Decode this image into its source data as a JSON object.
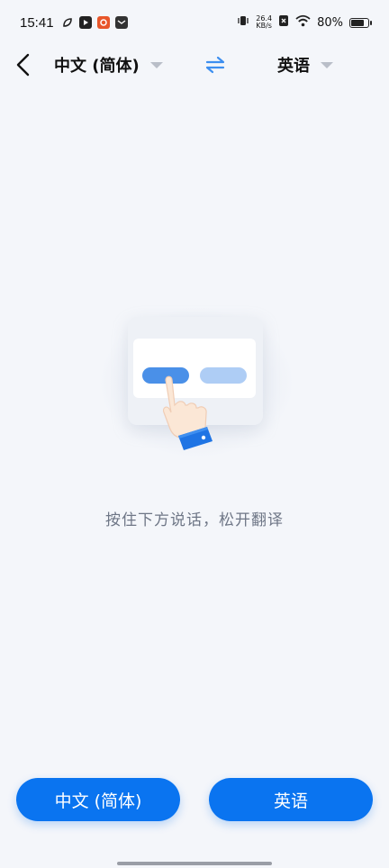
{
  "status_bar": {
    "time": "15:41",
    "net_speed_value": "26.4",
    "net_speed_unit": "KB/s",
    "battery_percent": "80%",
    "battery_level": 0.8
  },
  "header": {
    "source_language": "中文 (简体)",
    "target_language": "英语"
  },
  "hint_text": "按住下方说话，松开翻译",
  "buttons": {
    "left_label": "中文 (简体)",
    "right_label": "英语"
  },
  "colors": {
    "accent": "#0a74f0",
    "swap_icon": "#3d8ff0",
    "background": "#f4f6fa",
    "hint_text": "#6e7686"
  },
  "icons": {
    "back": "chevron-left-icon",
    "swap": "swap-arrows-icon",
    "dropdown": "caret-down-icon"
  }
}
